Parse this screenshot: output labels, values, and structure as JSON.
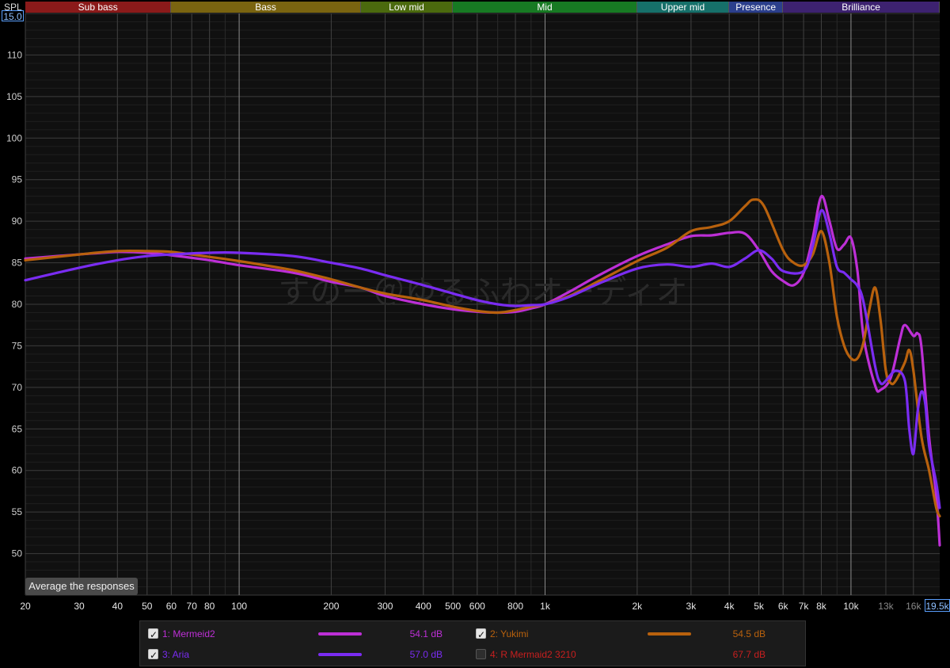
{
  "watermark": "すのー＠ゆるふわオーディオ",
  "controls": {
    "spl_label": "SPL",
    "ymax_value": "15.0",
    "xmax_value": "19.5k",
    "average_button": "Average the responses"
  },
  "bands": [
    {
      "label": "Sub bass",
      "color": "#8b1a1a",
      "from": 20,
      "to": 60
    },
    {
      "label": "Bass",
      "color": "#7a6410",
      "from": 60,
      "to": 250
    },
    {
      "label": "Low mid",
      "color": "#4b6a0e",
      "from": 250,
      "to": 500
    },
    {
      "label": "Mid",
      "color": "#177a23",
      "from": 500,
      "to": 2000
    },
    {
      "label": "Upper mid",
      "color": "#16706a",
      "from": 2000,
      "to": 4000
    },
    {
      "label": "Presence",
      "color": "#2b3f8c",
      "from": 4000,
      "to": 6000
    },
    {
      "label": "Brilliance",
      "color": "#3d2270",
      "from": 6000,
      "to": 19500
    }
  ],
  "legend": [
    {
      "label": "1: Mermeid2",
      "value": "54.1 dB",
      "checked": true,
      "color": "#bd2fd6"
    },
    {
      "label": "2: Yukimi",
      "value": "54.5 dB",
      "checked": true,
      "color": "#b8610d"
    },
    {
      "label": "3: Aria",
      "value": "57.0 dB",
      "checked": true,
      "color": "#7a2cf2"
    },
    {
      "label": "4: R Mermaid2 3210",
      "value": "67.7 dB",
      "checked": false,
      "color": "#c81f1f"
    }
  ],
  "chart_data": {
    "type": "line",
    "xscale": "log",
    "xlim": [
      20,
      19500
    ],
    "ylim": [
      45,
      115
    ],
    "grid": true,
    "x_ticks": [
      "20",
      "30",
      "40",
      "50",
      "60",
      "70",
      "80",
      "100",
      "200",
      "300",
      "400",
      "500",
      "600",
      "800",
      "1k",
      "2k",
      "3k",
      "4k",
      "5k",
      "6k",
      "7k",
      "8k",
      "10k",
      "13k",
      "16k"
    ],
    "y_ticks": [
      "50",
      "55",
      "60",
      "65",
      "70",
      "75",
      "80",
      "85",
      "90",
      "95",
      "100",
      "105",
      "110"
    ],
    "series": [
      {
        "name": "1: Mermeid2",
        "color": "#bd2fd6",
        "points": [
          [
            20,
            85.5
          ],
          [
            30,
            86.0
          ],
          [
            40,
            86.3
          ],
          [
            50,
            86.2
          ],
          [
            60,
            85.9
          ],
          [
            80,
            85.3
          ],
          [
            100,
            84.7
          ],
          [
            150,
            83.8
          ],
          [
            200,
            82.7
          ],
          [
            250,
            82.0
          ],
          [
            300,
            81.0
          ],
          [
            400,
            80.0
          ],
          [
            500,
            79.4
          ],
          [
            600,
            79.1
          ],
          [
            700,
            79.0
          ],
          [
            800,
            79.1
          ],
          [
            900,
            79.5
          ],
          [
            1000,
            80.0
          ],
          [
            1200,
            81.5
          ],
          [
            1500,
            83.5
          ],
          [
            2000,
            85.8
          ],
          [
            2500,
            87.2
          ],
          [
            3000,
            88.2
          ],
          [
            3500,
            88.3
          ],
          [
            4000,
            88.6
          ],
          [
            4500,
            88.5
          ],
          [
            5000,
            86.5
          ],
          [
            5500,
            84.0
          ],
          [
            6000,
            82.8
          ],
          [
            6500,
            82.3
          ],
          [
            7000,
            83.8
          ],
          [
            7500,
            88.0
          ],
          [
            8000,
            93.0
          ],
          [
            8500,
            90.0
          ],
          [
            9000,
            86.7
          ],
          [
            9500,
            87.2
          ],
          [
            10000,
            88.0
          ],
          [
            10500,
            84.0
          ],
          [
            11000,
            76.0
          ],
          [
            12000,
            70.2
          ],
          [
            12500,
            69.7
          ],
          [
            13500,
            71.2
          ],
          [
            14500,
            76.0
          ],
          [
            15000,
            77.5
          ],
          [
            16000,
            76.2
          ],
          [
            16500,
            76.5
          ],
          [
            17000,
            74.8
          ],
          [
            18000,
            64.0
          ],
          [
            19000,
            57.0
          ],
          [
            19500,
            51.0
          ]
        ]
      },
      {
        "name": "2: Yukimi",
        "color": "#b8610d",
        "points": [
          [
            20,
            85.3
          ],
          [
            30,
            86.0
          ],
          [
            40,
            86.4
          ],
          [
            50,
            86.4
          ],
          [
            60,
            86.3
          ],
          [
            80,
            85.7
          ],
          [
            100,
            85.2
          ],
          [
            150,
            84.1
          ],
          [
            200,
            83.0
          ],
          [
            250,
            82.0
          ],
          [
            300,
            81.3
          ],
          [
            400,
            80.5
          ],
          [
            500,
            79.7
          ],
          [
            600,
            79.2
          ],
          [
            700,
            79.0
          ],
          [
            800,
            79.3
          ],
          [
            900,
            79.7
          ],
          [
            1000,
            80.0
          ],
          [
            1200,
            81.0
          ],
          [
            1500,
            82.8
          ],
          [
            2000,
            85.2
          ],
          [
            2500,
            86.8
          ],
          [
            3000,
            88.8
          ],
          [
            3500,
            89.3
          ],
          [
            4000,
            90.0
          ],
          [
            4500,
            91.8
          ],
          [
            4800,
            92.6
          ],
          [
            5200,
            91.8
          ],
          [
            6000,
            86.5
          ],
          [
            6500,
            85.0
          ],
          [
            7000,
            84.7
          ],
          [
            7500,
            86.0
          ],
          [
            8000,
            88.8
          ],
          [
            8500,
            85.0
          ],
          [
            9000,
            78.5
          ],
          [
            9500,
            75.0
          ],
          [
            10000,
            73.5
          ],
          [
            10500,
            73.5
          ],
          [
            11000,
            75.5
          ],
          [
            11500,
            79.5
          ],
          [
            12000,
            82.0
          ],
          [
            12500,
            78.0
          ],
          [
            13000,
            72.0
          ],
          [
            13500,
            70.5
          ],
          [
            14000,
            70.8
          ],
          [
            15000,
            73.0
          ],
          [
            15500,
            74.5
          ],
          [
            16000,
            72.0
          ],
          [
            17000,
            64.0
          ],
          [
            18000,
            60.0
          ],
          [
            19000,
            55.5
          ],
          [
            19500,
            54.5
          ]
        ]
      },
      {
        "name": "3: Aria",
        "color": "#7a2cf2",
        "points": [
          [
            20,
            82.9
          ],
          [
            30,
            84.4
          ],
          [
            40,
            85.3
          ],
          [
            50,
            85.8
          ],
          [
            60,
            86.0
          ],
          [
            80,
            86.2
          ],
          [
            100,
            86.2
          ],
          [
            150,
            85.8
          ],
          [
            200,
            85.0
          ],
          [
            250,
            84.3
          ],
          [
            300,
            83.5
          ],
          [
            400,
            82.3
          ],
          [
            500,
            81.3
          ],
          [
            600,
            80.5
          ],
          [
            700,
            80.0
          ],
          [
            800,
            79.8
          ],
          [
            900,
            79.9
          ],
          [
            1000,
            80.0
          ],
          [
            1200,
            80.9
          ],
          [
            1500,
            82.5
          ],
          [
            2000,
            84.3
          ],
          [
            2500,
            84.8
          ],
          [
            3000,
            84.5
          ],
          [
            3500,
            84.9
          ],
          [
            4000,
            84.5
          ],
          [
            4500,
            85.5
          ],
          [
            5000,
            86.5
          ],
          [
            5500,
            85.5
          ],
          [
            6000,
            84.0
          ],
          [
            7000,
            84.0
          ],
          [
            7500,
            87.0
          ],
          [
            8000,
            91.3
          ],
          [
            8500,
            88.5
          ],
          [
            9000,
            84.5
          ],
          [
            9500,
            83.8
          ],
          [
            10000,
            83.0
          ],
          [
            10500,
            82.2
          ],
          [
            11000,
            80.2
          ],
          [
            12000,
            72.5
          ],
          [
            12500,
            70.5
          ],
          [
            13000,
            70.8
          ],
          [
            14000,
            72.0
          ],
          [
            15000,
            70.8
          ],
          [
            15500,
            65.0
          ],
          [
            16000,
            62.0
          ],
          [
            16500,
            67.0
          ],
          [
            17000,
            69.5
          ],
          [
            17500,
            68.0
          ],
          [
            18000,
            63.0
          ],
          [
            19000,
            58.5
          ],
          [
            19500,
            55.5
          ]
        ]
      }
    ]
  }
}
